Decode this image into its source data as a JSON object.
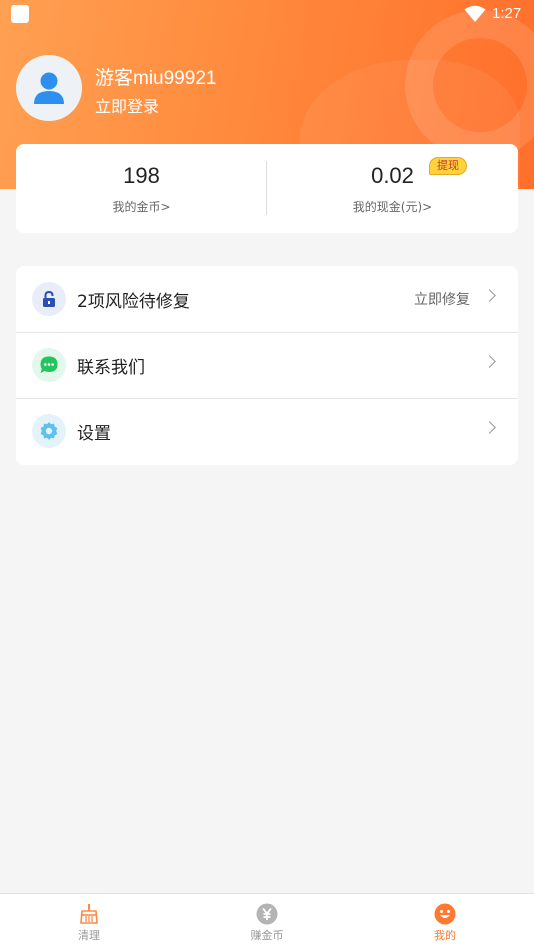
{
  "status_bar": {
    "time": "1:27"
  },
  "profile": {
    "username": "游客miu99921",
    "login_label": "立即登录"
  },
  "stats": {
    "coins": {
      "value": "198",
      "label": "我的金币>"
    },
    "cash": {
      "value": "0.02",
      "label": "我的现金(元)>",
      "badge": "提现"
    }
  },
  "menu": [
    {
      "label": "2项风险待修复",
      "action": "立即修复",
      "icon": "lock-icon",
      "icon_bg": "#e8edf8",
      "icon_color": "#2a4fb0"
    },
    {
      "label": "联系我们",
      "action": "",
      "icon": "chat-icon",
      "icon_bg": "#e3f7ea",
      "icon_color": "#22c55e"
    },
    {
      "label": "设置",
      "action": "",
      "icon": "gear-icon",
      "icon_bg": "#e4f3fa",
      "icon_color": "#5ec3ea"
    }
  ],
  "tabs": [
    {
      "label": "清理",
      "icon": "broom-icon",
      "active": false
    },
    {
      "label": "赚金币",
      "icon": "coin-icon",
      "active": false
    },
    {
      "label": "我的",
      "icon": "smile-icon",
      "active": true
    }
  ],
  "colors": {
    "accent": "#ff7a2f",
    "header_start": "#ffa052",
    "header_end": "#ff6f2b"
  }
}
